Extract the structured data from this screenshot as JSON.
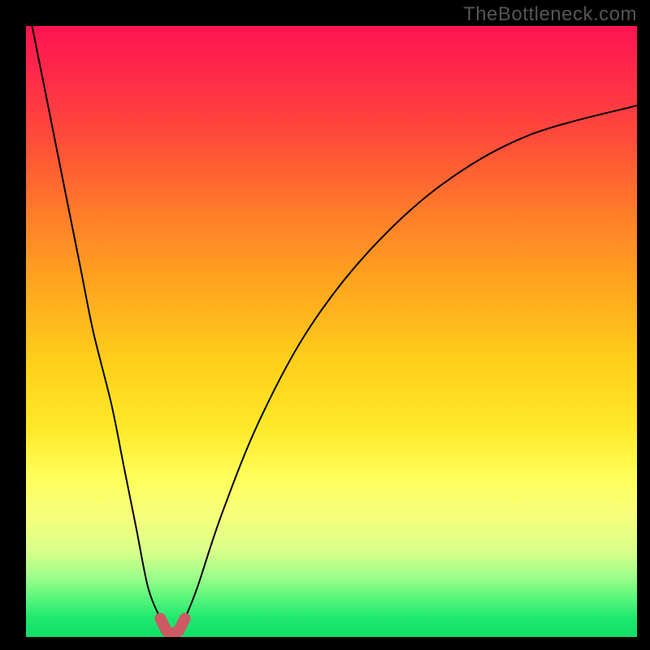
{
  "watermark": "TheBottleneck.com",
  "chart_data": {
    "type": "line",
    "title": "",
    "xlabel": "",
    "ylabel": "",
    "xlim": [
      0,
      100
    ],
    "ylim": [
      0,
      100
    ],
    "grid": false,
    "legend": false,
    "series": [
      {
        "name": "bottleneck-curve",
        "x": [
          1,
          3,
          5,
          7,
          9,
          11,
          14,
          16,
          18,
          20,
          22,
          23,
          24,
          25,
          26,
          28,
          32,
          38,
          46,
          56,
          68,
          82,
          100
        ],
        "y": [
          100,
          90,
          80,
          70,
          60,
          50,
          38,
          28,
          18,
          8,
          3,
          1,
          0.5,
          1,
          3,
          8,
          20,
          35,
          50,
          63,
          74,
          82,
          87
        ]
      },
      {
        "name": "optimal-marker",
        "x": [
          22,
          23,
          24,
          25,
          26
        ],
        "y": [
          3,
          1,
          0.5,
          1,
          3
        ]
      }
    ],
    "optimal_x": 24,
    "background_gradient": {
      "top_color": "#ff1450",
      "bottom_color": "#12df67"
    }
  }
}
